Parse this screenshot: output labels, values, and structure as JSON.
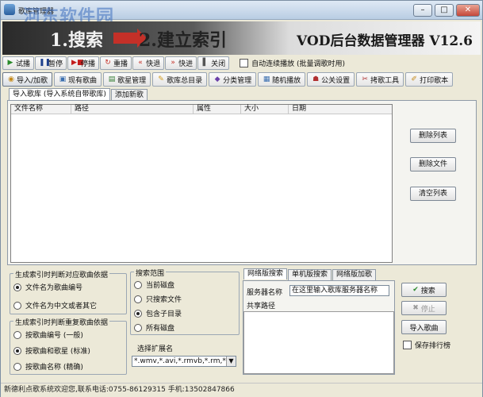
{
  "window": {
    "title": "歌库管理器",
    "watermark": "河东软件园"
  },
  "window_controls": {
    "minimize": "–",
    "maximize": "□",
    "close": "✕"
  },
  "banner": {
    "step1": "1.搜索",
    "step2": "2.建立索引",
    "product": "VOD后台数据管理器 V12.6"
  },
  "toolbar": {
    "buttons": [
      {
        "icon": "play-icon",
        "label": "试播"
      },
      {
        "icon": "pause-icon",
        "label": "暂停"
      },
      {
        "icon": "stop-icon",
        "label": "停播"
      },
      {
        "icon": "replay-icon",
        "label": "重播"
      },
      {
        "icon": "rewind-icon",
        "label": "快退"
      },
      {
        "icon": "forward-icon",
        "label": "快进"
      },
      {
        "icon": "close-icon",
        "label": "关闭"
      }
    ],
    "auto_play_label": "自动连续播放 (批量调歌时用)"
  },
  "main_tabs": [
    {
      "icon": "import-icon",
      "label": "导入/加歌",
      "active": true
    },
    {
      "icon": "song-icon",
      "label": "现有歌曲"
    },
    {
      "icon": "star-icon",
      "label": "歌星管理"
    },
    {
      "icon": "catalog-icon",
      "label": "歌库总目录"
    },
    {
      "icon": "category-icon",
      "label": "分类管理"
    },
    {
      "icon": "random-icon",
      "label": "随机播放"
    },
    {
      "icon": "settings-icon",
      "label": "公关设置"
    },
    {
      "icon": "tools-icon",
      "label": "拷歌工具"
    },
    {
      "icon": "print-icon",
      "label": "打印歌本"
    }
  ],
  "sub_tabs": [
    "导入歌库 (导入系统自带歌库)",
    "添加新歌"
  ],
  "file_list": {
    "columns": [
      "文件名称",
      "路径",
      "属性",
      "大小",
      "日期"
    ],
    "rows": []
  },
  "list_actions": [
    "删除列表",
    "删除文件",
    "清空列表"
  ],
  "match_group": {
    "title": "生成索引时判断对应歌曲依据",
    "options": [
      "文件名为歌曲编号",
      "文件名为中文或者其它"
    ],
    "selected": 0
  },
  "dup_group": {
    "title": "生成索引时判断重复歌曲依据",
    "options": [
      "按歌曲编号 (一般)",
      "按歌曲和歌星 (标准)",
      "按歌曲名称 (精确)"
    ],
    "selected": 1
  },
  "search_group": {
    "title": "搜索范围",
    "options": [
      "当前磁盘",
      "只搜索文件",
      "包含子目录",
      "所有磁盘"
    ],
    "selected": 2
  },
  "extension": {
    "label": "选择扩展名",
    "value": "*.wmv,*.avi,*.rmvb,*.rm,*."
  },
  "net_tabs": [
    "网络版搜索",
    "单机版搜索",
    "网络版加歌"
  ],
  "net_search": {
    "server_label": "服务器名称",
    "server_placeholder": "在这里输入歌库服务器名称",
    "share_label": "共享路径"
  },
  "right_actions": {
    "search": "搜索",
    "stop": "停止",
    "import": "导入歌曲",
    "save_rank": "保存排行榜"
  },
  "status": "新德利点歌系统欢迎您,联系电话:0755-86129315 手机:13502847866",
  "colors": {
    "accent": "#c43028",
    "banner": "#3a3a3a"
  }
}
